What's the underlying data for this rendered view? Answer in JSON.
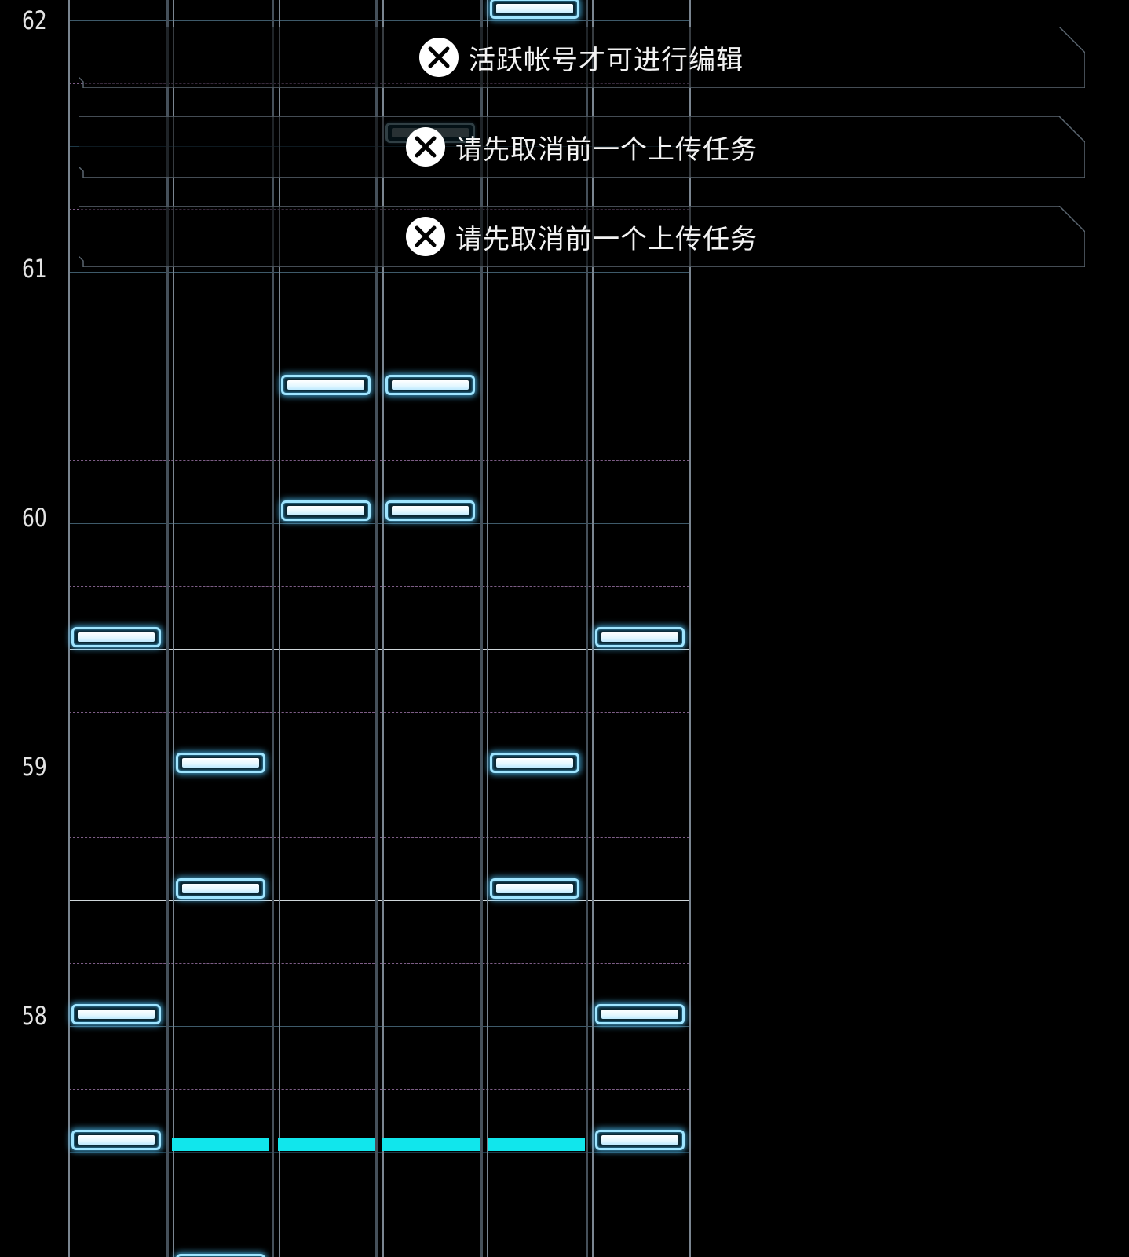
{
  "editor": {
    "measures": [
      {
        "label": "62",
        "key": "m62"
      },
      {
        "label": "61",
        "key": "m61"
      },
      {
        "label": "60",
        "key": "m60"
      },
      {
        "label": "59",
        "key": "m59"
      },
      {
        "label": "58",
        "key": "m58"
      }
    ],
    "lanes": 6,
    "colors": {
      "background": "#000000",
      "note_glow": "#50c8ff",
      "note_fill": "#e3f7ff",
      "playhead": "#11e6ec",
      "beat_line": "#7d5d86",
      "half_line": "#cfd6da"
    }
  },
  "toasts": [
    {
      "icon": "close-circle-icon",
      "message": "活跃帐号才可进行编辑"
    },
    {
      "icon": "close-circle-icon",
      "message": "请先取消前一个上传任务"
    },
    {
      "icon": "close-circle-icon",
      "message": "请先取消前一个上传任务"
    }
  ]
}
